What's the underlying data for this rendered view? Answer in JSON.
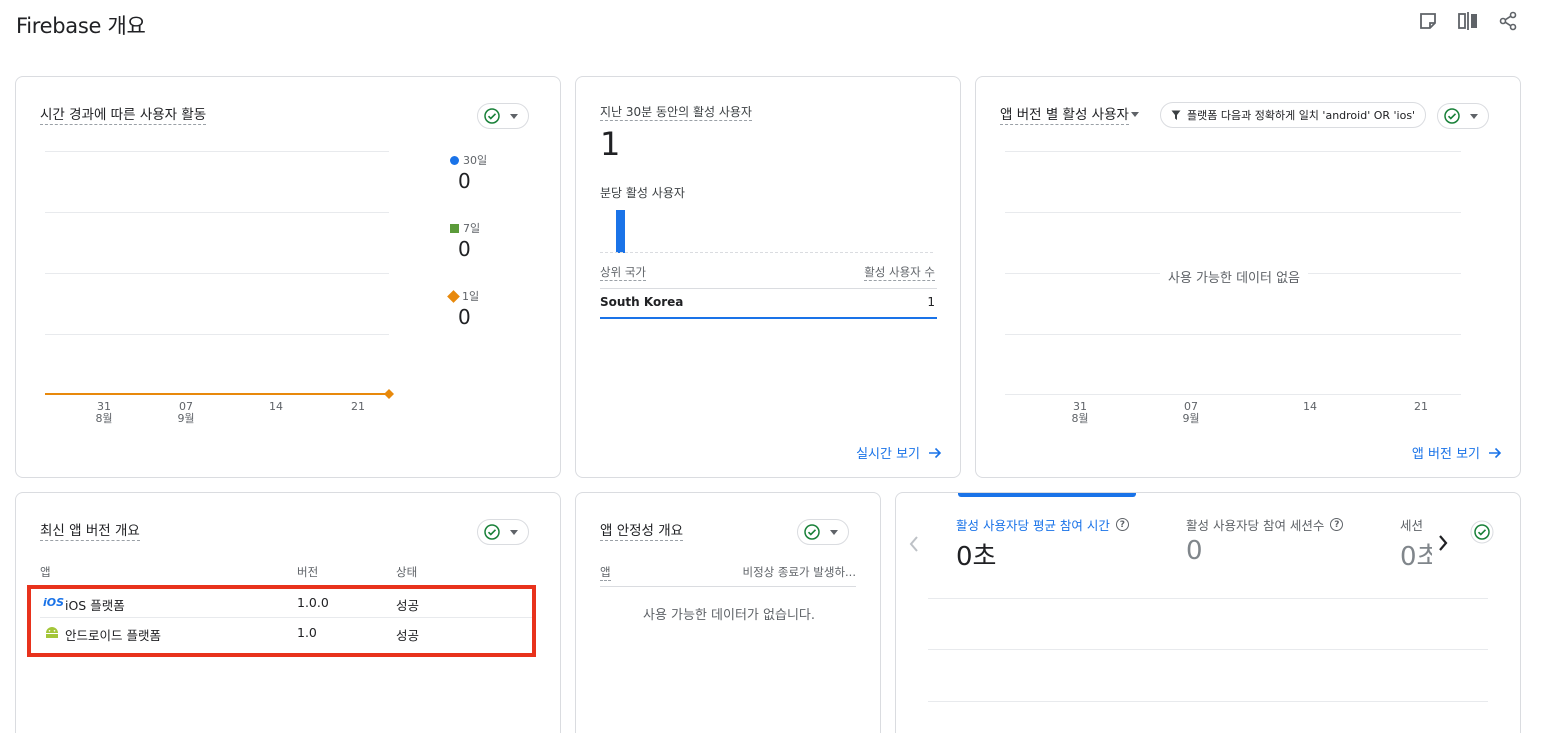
{
  "page": {
    "title": "Firebase 개요"
  },
  "toolbar": {
    "icons": [
      "note-icon",
      "compare-icon",
      "share-icon"
    ]
  },
  "user_activity": {
    "title": "시간 경과에 따른 사용자 활동",
    "legend": [
      {
        "label": "30일",
        "value": "0",
        "color": "#1a73e8",
        "shape": "circle"
      },
      {
        "label": "7일",
        "value": "0",
        "color": "#5b9b3a",
        "shape": "square"
      },
      {
        "label": "1일",
        "value": "0",
        "color": "#e8890c",
        "shape": "diamond"
      }
    ],
    "x_ticks": [
      {
        "day": "31",
        "month": "8월"
      },
      {
        "day": "07",
        "month": "9월"
      },
      {
        "day": "14",
        "month": ""
      },
      {
        "day": "21",
        "month": ""
      }
    ]
  },
  "realtime": {
    "title": "지난 30분 동안의 활성 사용자",
    "value": "1",
    "per_minute_label": "분당 활성 사용자",
    "country_header": "상위 국가",
    "users_header": "활성 사용자 수",
    "rows": [
      {
        "country": "South Korea",
        "users": "1"
      }
    ],
    "link": "실시간 보기"
  },
  "app_version_users": {
    "title": "앱 버전 별 활성 사용자",
    "filter": "플랫폼 다음과 정확하게 일치 'android' OR 'ios'",
    "empty": "사용 가능한 데이터 없음",
    "x_ticks": [
      {
        "day": "31",
        "month": "8월"
      },
      {
        "day": "07",
        "month": "9월"
      },
      {
        "day": "14",
        "month": ""
      },
      {
        "day": "21",
        "month": ""
      }
    ],
    "link": "앱 버전 보기"
  },
  "latest_versions": {
    "title": "최신 앱 버전 개요",
    "headers": {
      "app": "앱",
      "version": "버전",
      "status": "상태"
    },
    "rows": [
      {
        "icon": "ios-icon",
        "icon_text": "iOS",
        "app": "iOS 플랫폼",
        "version": "1.0.0",
        "status": "성공"
      },
      {
        "icon": "android-icon",
        "app": "안드로이드 플랫폼",
        "version": "1.0",
        "status": "성공"
      }
    ]
  },
  "stability": {
    "title": "앱 안정성 개요",
    "headers": {
      "app": "앱",
      "crash": "비정상 종료가 발생하..."
    },
    "empty": "사용 가능한 데이터가 없습니다."
  },
  "engagement": {
    "tabs": [
      {
        "label": "활성 사용자당 평균 참여 시간",
        "value": "0초",
        "active": true
      },
      {
        "label": "활성 사용자당 참여 세션수",
        "value": "0",
        "active": false
      },
      {
        "label": "세션",
        "value": "0초",
        "active": false
      }
    ]
  },
  "colors": {
    "accent": "#1a73e8",
    "success": "#188038",
    "highlight": "#e8321c"
  }
}
